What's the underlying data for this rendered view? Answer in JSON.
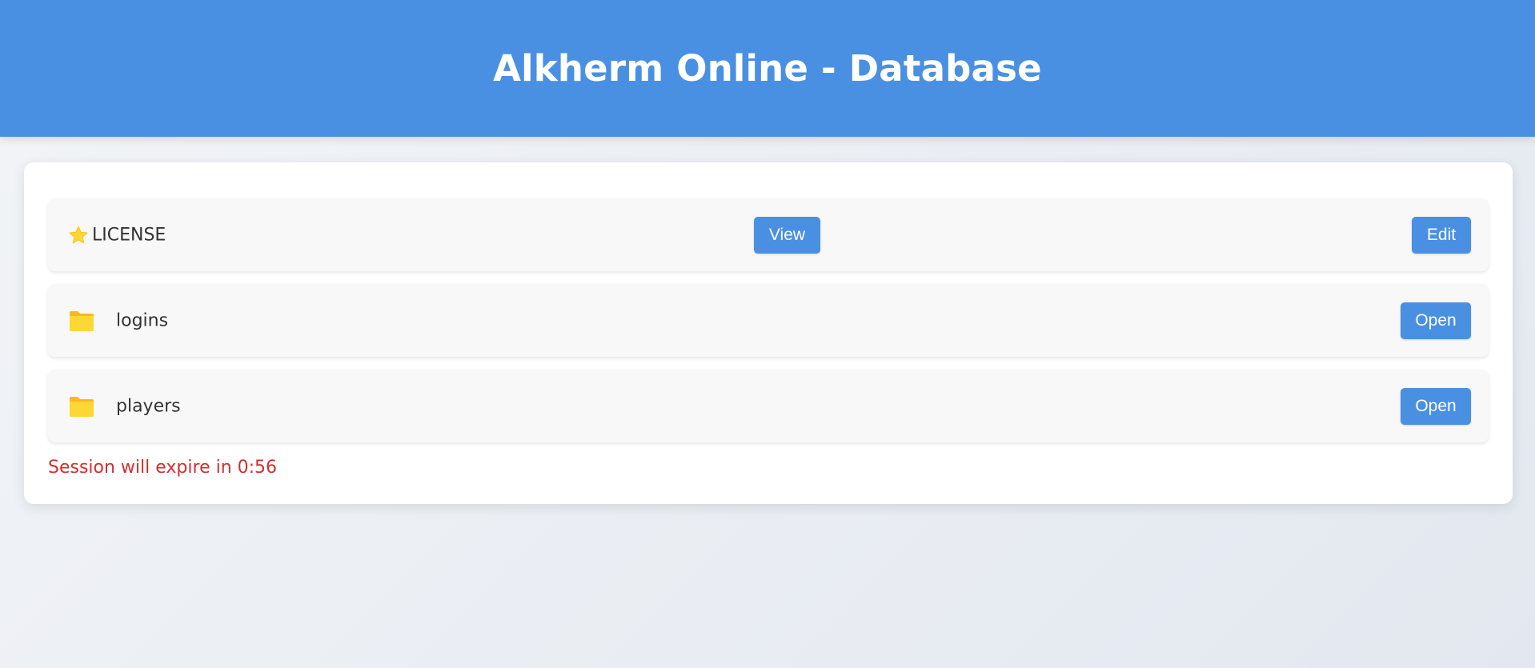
{
  "header": {
    "title": "Alkherm Online - Database"
  },
  "items": [
    {
      "icon": "star-icon",
      "name": "LICENSE",
      "actions": [
        "View",
        "Edit"
      ]
    },
    {
      "icon": "folder-icon",
      "name": "logins",
      "actions": [
        "Open"
      ]
    },
    {
      "icon": "folder-icon",
      "name": "players",
      "actions": [
        "Open"
      ]
    }
  ],
  "session": {
    "message": "Session will expire in 0:56"
  },
  "colors": {
    "accent": "#4a90e2",
    "star": "#fdd835",
    "folder": "#fdd835",
    "warning": "#d32f2f"
  }
}
